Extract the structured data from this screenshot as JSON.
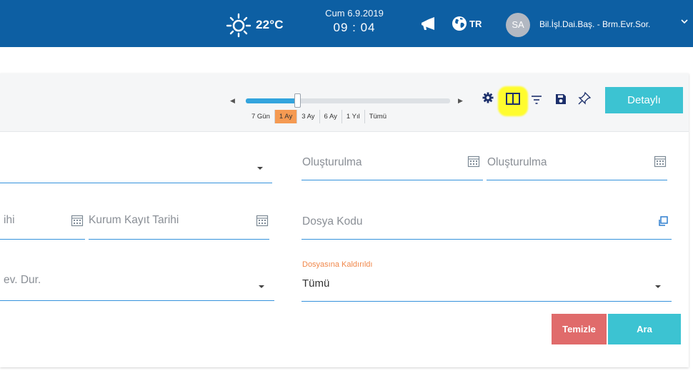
{
  "topbar": {
    "temperature": "22°C",
    "date": "Cum 6.9.2019",
    "time": "09 : 04",
    "language": "TR",
    "avatar_initials": "SA",
    "user_label": "Bil.İşl.Dai.Baş. - Brm.Evr.Sor.",
    "icons": [
      "sun-icon",
      "megaphone-icon",
      "globe-icon",
      "chevron-down-icon"
    ]
  },
  "toolbar": {
    "date_ranges": [
      "7 Gün",
      "1 Ay",
      "3 Ay",
      "6 Ay",
      "1 Yıl",
      "Tümü"
    ],
    "selected_range": "1 Ay",
    "detay_label": "Detaylı",
    "icons": [
      "gear-icon",
      "columns-icon",
      "filter-icon",
      "save-icon",
      "pin-icon"
    ]
  },
  "form": {
    "row1": {
      "created_from_label": "Oluşturulma",
      "created_to_label": "Oluşturulma"
    },
    "row2": {
      "partial_left_label": "ihi",
      "kurum_kayit_label": "Kurum Kayıt Tarihi",
      "dosya_kodu_label": "Dosya Kodu"
    },
    "row3": {
      "partial_left_label": "ev. Dur.",
      "dosyasina_label": "Dosyasına Kaldırıldı",
      "dosyasina_value": "Tümü"
    }
  },
  "actions": {
    "clear_label": "Temizle",
    "search_label": "Ara"
  },
  "colors": {
    "topbar": "#0d5fa3",
    "accent": "#3cc3d2",
    "danger": "#e06b6b",
    "field_line": "#3592dc",
    "highlight": "#fffc2e",
    "selected_range": "#f59a52"
  }
}
